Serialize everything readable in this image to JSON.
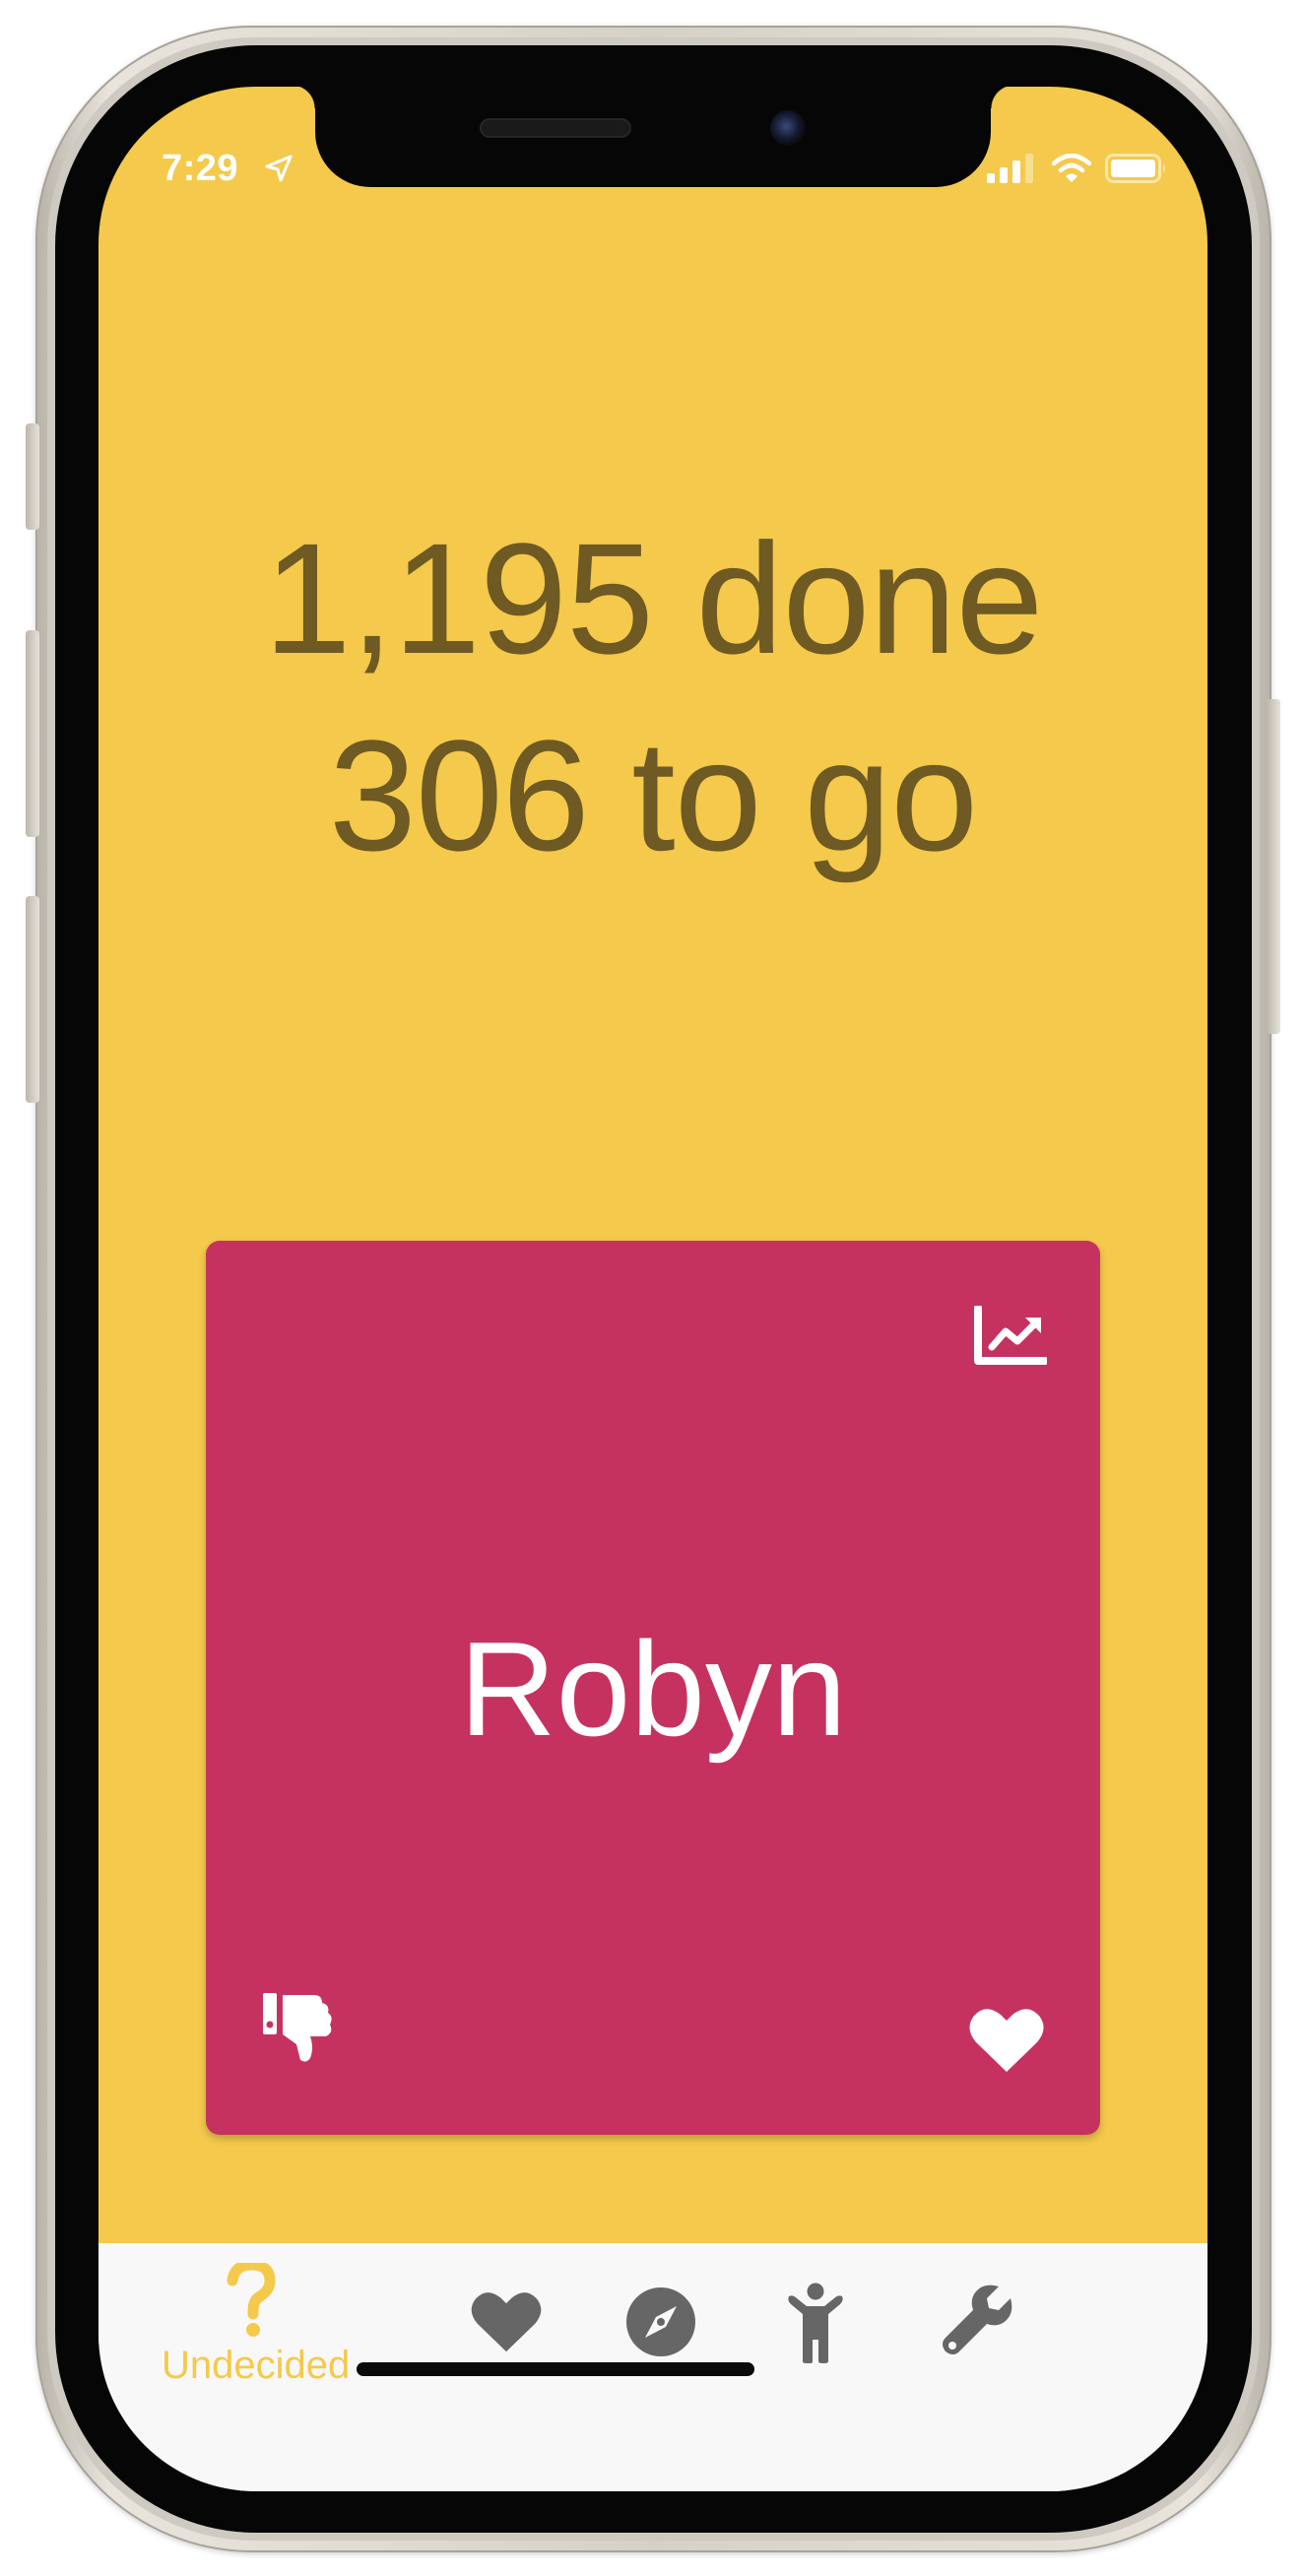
{
  "status_bar": {
    "time": "7:29",
    "icons": [
      "location-arrow-icon",
      "cellular-signal-icon",
      "wifi-icon",
      "battery-icon"
    ]
  },
  "progress": {
    "done_line": "1,195 done",
    "to_go_line": "306 to go"
  },
  "card": {
    "name": "Robyn",
    "color": "#c6325f",
    "icons": [
      "trend-chart-icon",
      "thumbs-down-icon",
      "heart-icon"
    ]
  },
  "tab_bar": {
    "tabs": [
      {
        "icon": "question-mark-icon",
        "label": "Undecided",
        "active": true
      },
      {
        "icon": "heart-icon",
        "label": "",
        "active": false
      },
      {
        "icon": "compass-icon",
        "label": "",
        "active": false
      },
      {
        "icon": "child-icon",
        "label": "",
        "active": false
      },
      {
        "icon": "wrench-icon",
        "label": "",
        "active": false
      }
    ]
  },
  "colors": {
    "background": "#f4c94c",
    "progress_text": "#6e5a22",
    "card": "#c6325f",
    "tab_bar": "#f8f8f8",
    "tab_active": "#f4c94c",
    "tab_inactive": "#666666"
  }
}
